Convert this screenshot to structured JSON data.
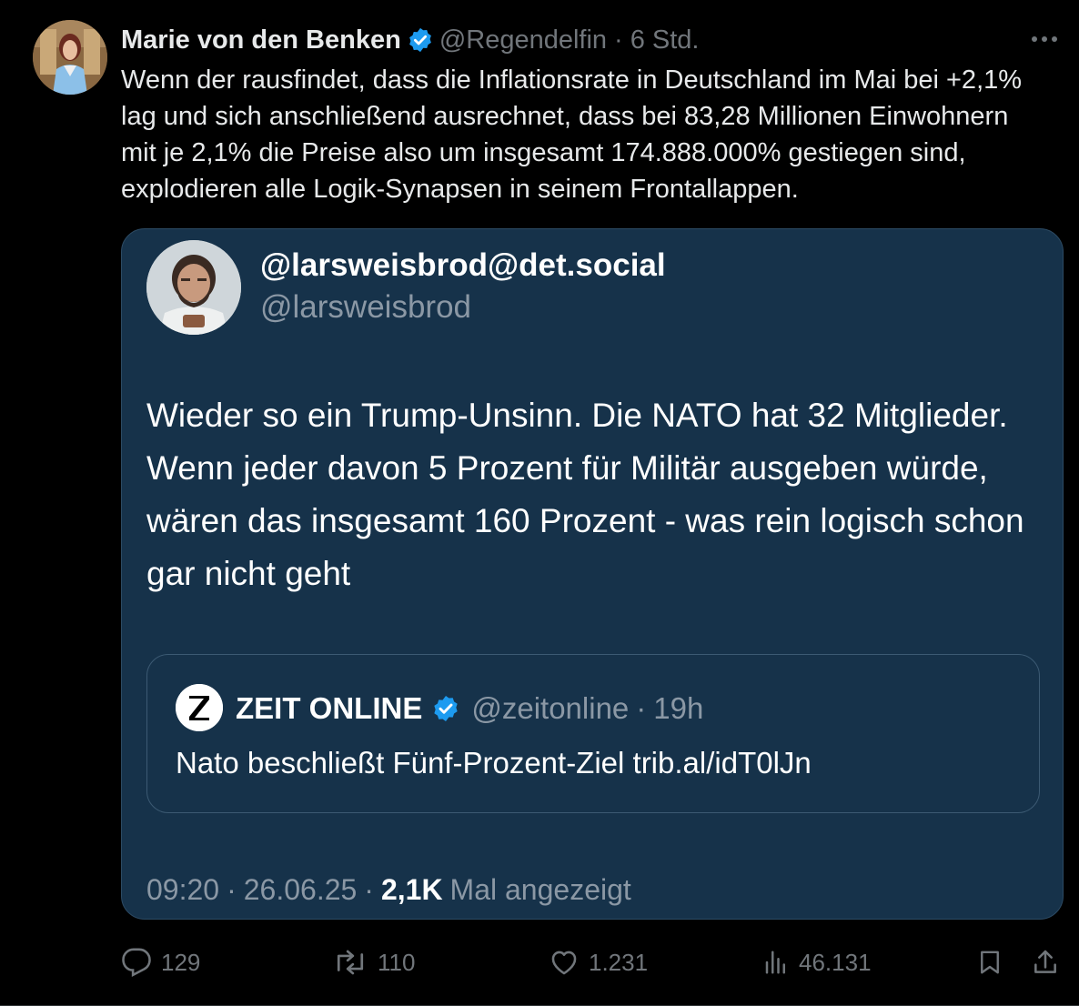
{
  "post": {
    "author_name": "Marie von den Benken",
    "author_handle": "@Regendelfin",
    "separator": "·",
    "time": "6 Std.",
    "text": "Wenn der rausfindet, dass die Inflationsrate in Deutschland im Mai bei +2,1% lag und sich anschließend ausrechnet, dass bei 83,28 Millionen Einwohnern mit je 2,1% die Preise also um insgesamt 174.888.000% gestiegen sind, explodieren alle Logik-Synapsen in seinem Frontallappen."
  },
  "embed": {
    "name": "@larsweisbrod@det.social",
    "handle": "@larsweisbrod",
    "text": "Wieder so ein Trump-Unsinn. Die NATO hat 32 Mitglieder. Wenn jeder davon 5 Prozent für Militär ausgeben würde, wären das insgesamt 160 Prozent - was rein logisch schon gar nicht geht",
    "quoted": {
      "name": "ZEIT ONLINE",
      "handle": "@zeitonline",
      "separator": "·",
      "time": "19h",
      "text": "Nato beschließt Fünf-Prozent-Ziel trib.al/idT0lJn"
    },
    "meta": {
      "time": "09:20",
      "separator": "·",
      "date": "26.06.25",
      "separator2": "·",
      "views": "2,1K",
      "views_label": "Mal angezeigt"
    }
  },
  "actions": {
    "replies": "129",
    "reposts": "110",
    "likes": "1.231",
    "views": "46.131"
  },
  "icons": {
    "verified": "verified-badge-icon",
    "more": "more-icon",
    "reply": "reply-icon",
    "repost": "repost-icon",
    "like": "heart-icon",
    "views": "views-icon",
    "bookmark": "bookmark-icon",
    "share": "share-icon"
  },
  "colors": {
    "background": "#000000",
    "verified": "#1d9bf0",
    "embed_background": "#16324a",
    "muted": "#71767b"
  }
}
